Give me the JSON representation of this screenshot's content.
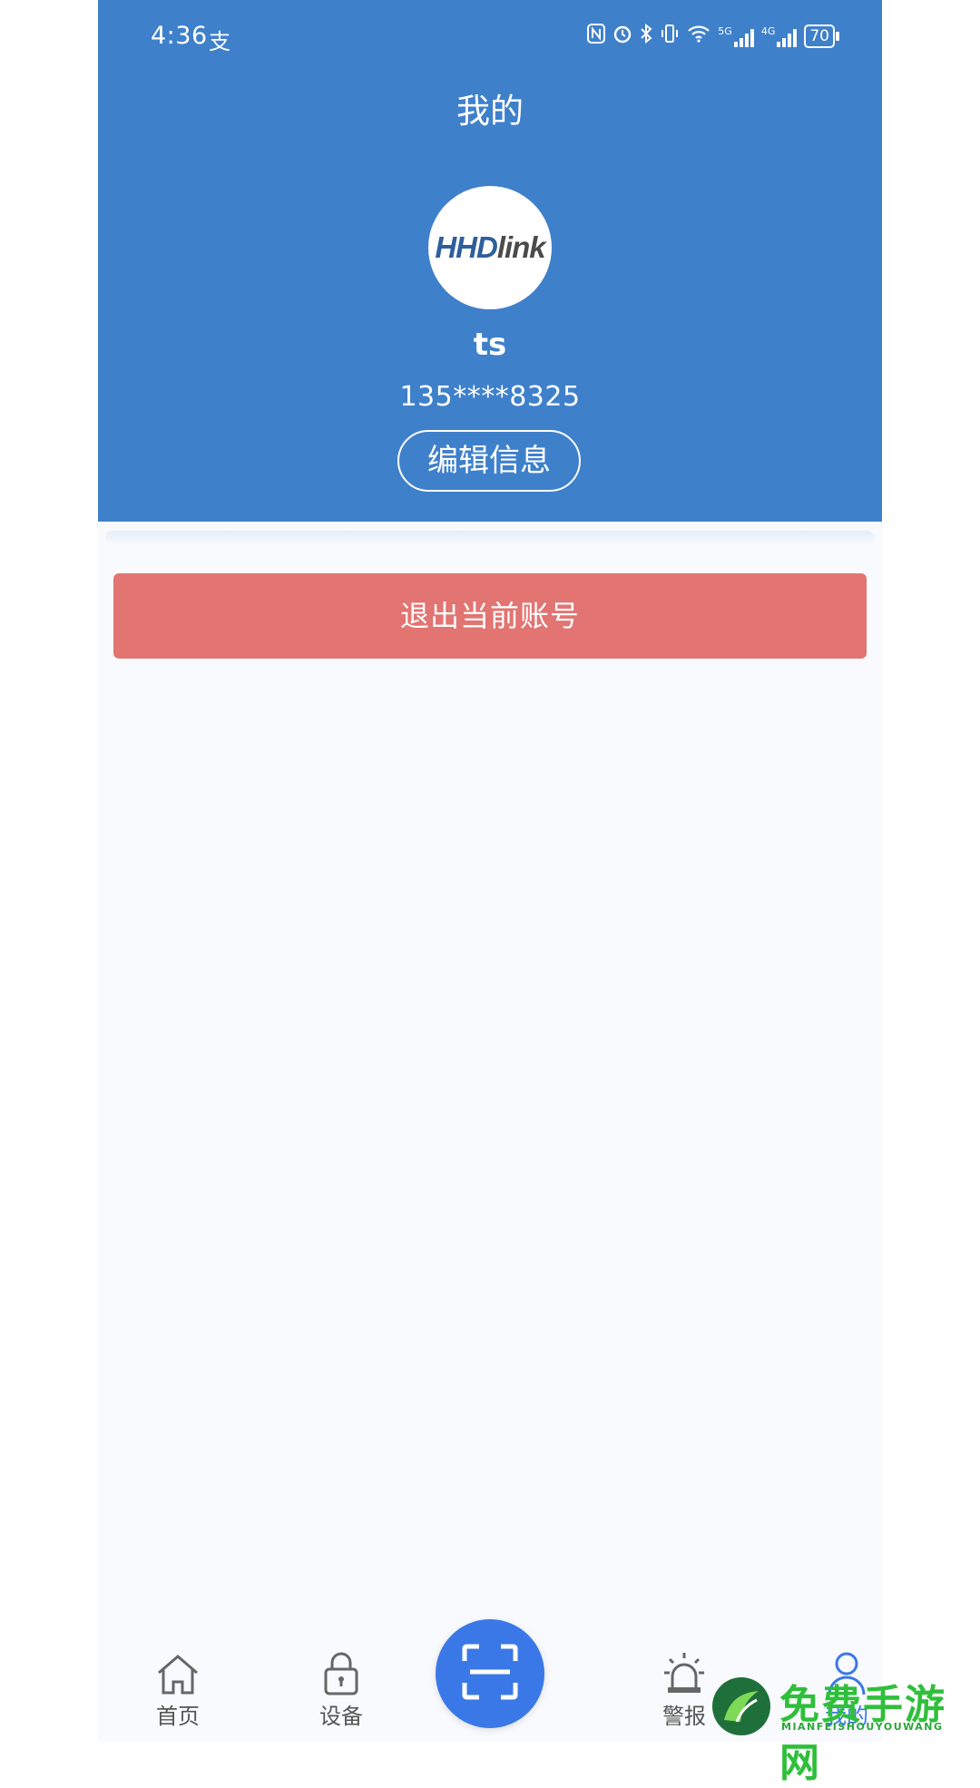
{
  "status_bar": {
    "time": "4:36",
    "app_icon": "支",
    "net_5g": "5G",
    "net_4g": "4G",
    "battery": "70"
  },
  "header": {
    "title": "我的",
    "avatar_logo_part1": "HHD",
    "avatar_logo_part2": "link",
    "username": "ts",
    "phone": "135****8325",
    "edit_label": "编辑信息"
  },
  "logout_label": "退出当前账号",
  "tabs": [
    {
      "label": "首页",
      "icon": "home-icon"
    },
    {
      "label": "设备",
      "icon": "lock-icon"
    },
    {
      "label": "",
      "icon": "scan-icon"
    },
    {
      "label": "警报",
      "icon": "alarm-icon"
    },
    {
      "label": "我的",
      "icon": "user-icon"
    }
  ],
  "colors": {
    "header": "#3f80cb",
    "logout": "#e27472",
    "scan": "#3b78e7",
    "background": "#f8fafd"
  },
  "watermark": {
    "text": "免费手游网",
    "sub": "MIANFEISHOUYOUWANG"
  }
}
